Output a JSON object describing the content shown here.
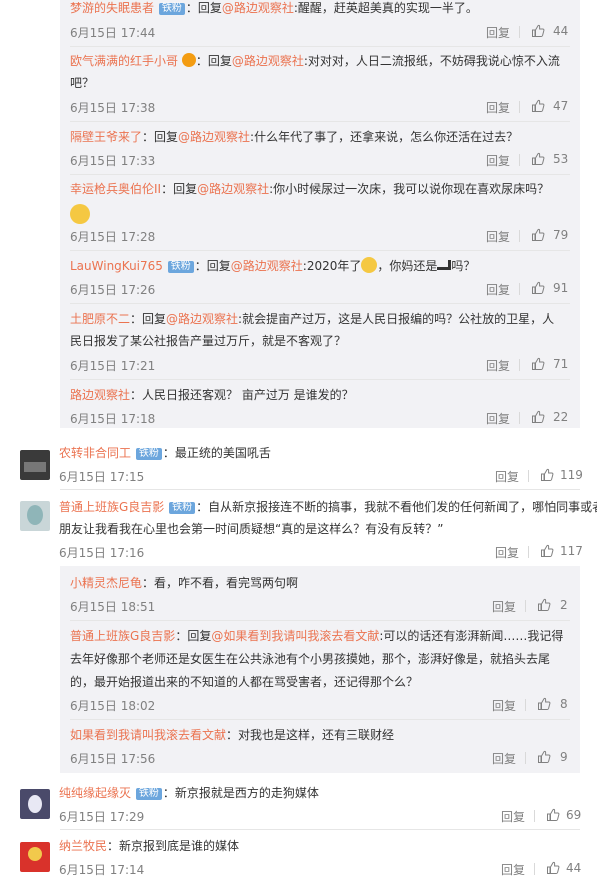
{
  "comments": {
    "c1": {
      "name": "梦游的失眠患者",
      "badge": "铁粉",
      "reply_prefix": "：回复",
      "at": "@路边观察社",
      "text": ":醒醒，赶英超美真的实现一半了。",
      "time": "6月15日 17:44",
      "reply": "回复",
      "likes": "44"
    },
    "c2": {
      "name": "欧气满满的红手小哥",
      "reply_prefix": "：回复",
      "at": "@路边观察社",
      "text1": ":对对对，人日二流报纸，不妨碍我说心惊不入流",
      "text2": "吧？",
      "time": "6月15日 17:38",
      "reply": "回复",
      "likes": "47"
    },
    "c3": {
      "name": "隔壁王爷来了",
      "reply_prefix": "：回复",
      "at": "@路边观察社",
      "text": ":什么年代了事了，还拿来说，怎么你还活在过去？",
      "time": "6月15日 17:33",
      "reply": "回复",
      "likes": "53"
    },
    "c4": {
      "name": "幸运枪兵奥伯伦II",
      "reply_prefix": "：回复",
      "at": "@路边观察社",
      "text": ":你小时候尿过一次床，我可以说你现在喜欢尿床吗？",
      "time": "6月15日 17:28",
      "reply": "回复",
      "likes": "79"
    },
    "c5": {
      "name": "LauWingKui765",
      "badge": "铁粉",
      "reply_prefix": "：回复",
      "at": "@路边观察社",
      "text_a": ":2020年了",
      "text_b": "，你妈还是",
      "text_c": "吗？",
      "time": "6月15日 17:26",
      "reply": "回复",
      "likes": "91"
    },
    "c6": {
      "name": "土肥原不二",
      "reply_prefix": "：回复",
      "at": "@路边观察社",
      "text1": ":就会提亩产过万，这是人民日报编的吗？公社放的卫星，人",
      "text2": "民日报发了某公社报告产量过万斤，就是不客观了？",
      "time": "6月15日 17:21",
      "reply": "回复",
      "likes": "71"
    },
    "c7": {
      "name": "路边观察社",
      "text": "：人民日报还客观？ 亩产过万 是谁发的？",
      "time": "6月15日 17:18",
      "reply": "回复",
      "likes": "22"
    },
    "t1": {
      "name": "农转非合同工",
      "badge": "铁粉",
      "text": "：最正统的美国吼舌",
      "time": "6月15日 17:15",
      "reply": "回复",
      "likes": "119"
    },
    "t2": {
      "name": "普通上班族G良吉影",
      "badge": "铁粉",
      "text1": "：自从新京报接连不断的搞事，我就不看他们发的任何新闻了，哪怕同事或者",
      "text2": "朋友让我看我在心里也会第一时间质疑想“真的是这样么？有没有反转？”",
      "time": "6月15日 17:16",
      "reply": "回复",
      "likes": "117"
    },
    "r1": {
      "name": "小精灵杰尼龟",
      "text": "：看，咋不看，看完骂两句啊",
      "time": "6月15日 18:51",
      "reply": "回复",
      "likes": "2"
    },
    "r2": {
      "name": "普通上班族G良吉影",
      "reply_prefix": "：回复",
      "at": "@如果看到我请叫我滚去看文献",
      "text1": ":可以的话还有澎湃新闻……我记得",
      "text2": "去年好像那个老师还是女医生在公共泳池有个小男孩摸她，那个，澎湃好像是，就掐头去尾",
      "text3": "的，最开始报道出来的不知道的人都在骂受害者，还记得那个么？",
      "time": "6月15日 18:02",
      "reply": "回复",
      "likes": "8"
    },
    "r3": {
      "name": "如果看到我请叫我滚去看文献",
      "text": "：对我也是这样，还有三联财经",
      "time": "6月15日 17:56",
      "reply": "回复",
      "likes": "9"
    },
    "t3": {
      "name": "纯纯缘起缘灭",
      "badge": "铁粉",
      "text": "：新京报就是西方的走狗媒体",
      "time": "6月15日 17:29",
      "reply": "回复",
      "likes": "69"
    },
    "t4": {
      "name": "纳兰牧民",
      "text": "：新京报到底是谁的媒体",
      "time": "6月15日 17:14",
      "reply": "回复",
      "likes": "44"
    }
  },
  "colors": {
    "name": "#eb7350",
    "badge": "#6ca6dd",
    "meta": "#808080",
    "reply_bg": "#f2f2f5"
  },
  "icons": {
    "like": "thumbs-up-icon",
    "emoji": "smiley-emoji",
    "shoe": "high-heel-icon"
  }
}
